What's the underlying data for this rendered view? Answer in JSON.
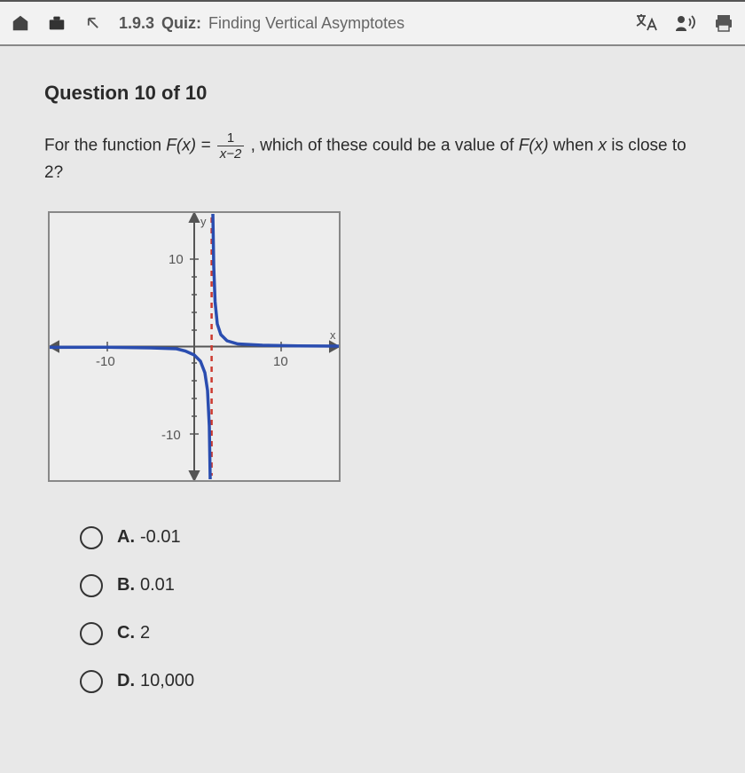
{
  "header": {
    "number": "1.9.3",
    "kind": "Quiz:",
    "title": "Finding Vertical Asymptotes"
  },
  "question": {
    "heading": "Question 10 of 10",
    "prefix": "For the function ",
    "func_lhs": "F(x) = ",
    "frac_num": "1",
    "frac_den": "x−2",
    "middle": ", which of these could be a value of ",
    "func_name": "F(x)",
    "middle2": " when ",
    "var": "x",
    "suffix": " is close to 2?"
  },
  "chart_data": {
    "type": "line",
    "title": "",
    "xlabel": "x",
    "ylabel": "y",
    "xlim": [
      -15,
      15
    ],
    "ylim": [
      -15,
      15
    ],
    "x_ticks": [
      -10,
      10
    ],
    "y_ticks": [
      -10,
      10
    ],
    "asymptote_x": 2,
    "series": [
      {
        "name": "F(x) = 1/(x-2)",
        "x": [
          -15,
          -10,
          -5,
          -2,
          0,
          1,
          1.5,
          1.8,
          1.9,
          1.95,
          2.05,
          2.1,
          2.2,
          2.5,
          3,
          4,
          7,
          12,
          15
        ],
        "y": [
          -0.059,
          -0.083,
          -0.143,
          -0.25,
          -0.5,
          -1,
          -2,
          -5,
          -10,
          -20,
          20,
          10,
          5,
          2,
          1,
          0.5,
          0.2,
          0.1,
          0.077
        ]
      }
    ]
  },
  "graph_labels": {
    "y_axis": "y",
    "x_axis": "x",
    "tick_pos_y": "10",
    "tick_neg_y": "-10",
    "tick_pos_x": "10",
    "tick_neg_x": "-10"
  },
  "answers": [
    {
      "letter": "A.",
      "text": "-0.01"
    },
    {
      "letter": "B.",
      "text": "0.01"
    },
    {
      "letter": "C.",
      "text": "2"
    },
    {
      "letter": "D.",
      "text": "10,000"
    }
  ]
}
